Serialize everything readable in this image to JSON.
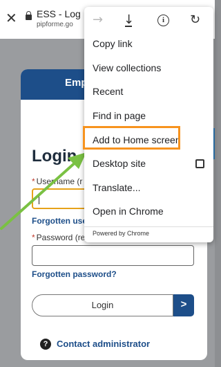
{
  "browser": {
    "tab_title": "ESS - Log",
    "url": "pipforme.go"
  },
  "page": {
    "header_title": "Emp",
    "login_title": "Login",
    "username_label": "Username (r",
    "forgotten_username": "Forgotten use",
    "password_label": "Password (re",
    "forgotten_password": "Forgotten password?",
    "login_button": "Login",
    "login_arrow": ">",
    "help_symbol": "?",
    "contact_admin": "Contact administrator"
  },
  "menu": {
    "items": [
      {
        "label": "Copy link"
      },
      {
        "label": "View collections"
      },
      {
        "label": "Recent"
      },
      {
        "label": "Find in page"
      },
      {
        "label": "Add to Home screen"
      },
      {
        "label": "Desktop site"
      },
      {
        "label": "Translate..."
      },
      {
        "label": "Open in Chrome"
      }
    ],
    "desktop_site_checked": false,
    "powered_by": "Powered by Chrome",
    "icons": [
      "forward-icon",
      "download-icon",
      "info-icon",
      "reload-icon"
    ]
  },
  "colors": {
    "brand": "#1d4e89",
    "highlight": "#f7931e",
    "annotation_arrow": "#7ac143",
    "input_focus": "#e6a21a"
  }
}
